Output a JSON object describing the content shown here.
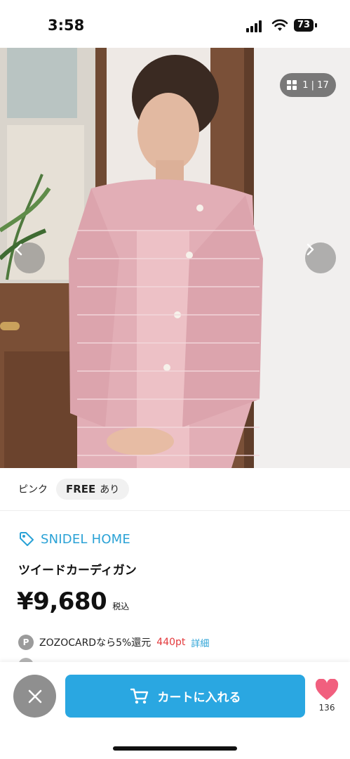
{
  "status_bar": {
    "time": "3:58",
    "battery": "73"
  },
  "gallery": {
    "counter": "1 | 17"
  },
  "variation": {
    "color": "ピンク",
    "size": "FREE",
    "availability": "あり"
  },
  "product": {
    "brand": "SNIDEL HOME",
    "name": "ツイードカーディガン",
    "price": "¥9,680",
    "tax_label": "税込"
  },
  "points": {
    "badge": "P",
    "text": "ZOZOCARDなら5%還元",
    "value": "440pt",
    "detail_link": "詳細"
  },
  "actions": {
    "cart_label": "カートに入れる",
    "favorite_count": "136"
  },
  "colors": {
    "accent": "#2aa7e1",
    "brand_text": "#2aa2d6",
    "points_red": "#e3393c",
    "favorite_pink": "#f15f7e",
    "close_gray": "#8f8f8f"
  },
  "icons": [
    "signal-icon",
    "wifi-icon",
    "battery-icon",
    "grid-icon",
    "chevron-left-icon",
    "chevron-right-icon",
    "tag-icon",
    "close-icon",
    "cart-icon",
    "heart-icon"
  ]
}
